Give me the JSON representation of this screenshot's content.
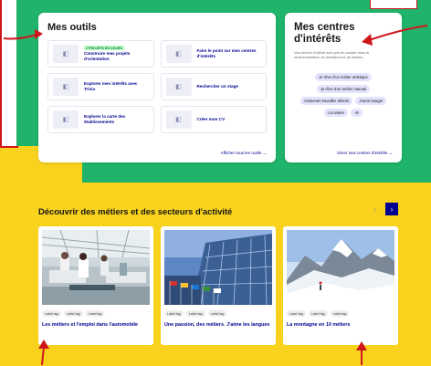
{
  "tools": {
    "title": "Mes outils",
    "items": [
      {
        "badge": "2 PROJETS EN COURS",
        "label": "Construire mes projets d'orientation"
      },
      {
        "badge": "",
        "label": "Faire le point sur mes centres d'intérêts"
      },
      {
        "badge": "",
        "label": "Explorer mes intérêts avec Trivia"
      },
      {
        "badge": "",
        "label": "Rechercher un stage"
      },
      {
        "badge": "",
        "label": "Explorer la carte des établissements"
      },
      {
        "badge": "",
        "label": "Créer mon CV"
      }
    ],
    "footer_link": "Afficher tous les outils →"
  },
  "centres": {
    "title_line1": "Mes centres",
    "title_line2": "d'intérêts",
    "description": "Vos centres d'intérêt sont pris en compte dans la recommandation de formations et de métiers.",
    "tags": [
      "Je rêve d'un métier artistique",
      "Je rêve d'un métier manuel",
      "J'aimerais travailler dehors",
      "J'aime bouger",
      "La nature",
      "+5"
    ],
    "footer_link": "Gérer mes centres d'intérêts →"
  },
  "discover": {
    "title": "Découvrir des métiers et des secteurs d'activité",
    "prev_label": "‹",
    "next_label": "›",
    "cards": [
      {
        "tags": [
          "Label tag",
          "Label tag",
          "Label tag"
        ],
        "title": "Les métiers et l'emploi dans l'automobile"
      },
      {
        "tags": [
          "Label tag",
          "Label tag",
          "Label tag"
        ],
        "title": "Une passion, des métiers. J'aime les langues"
      },
      {
        "tags": [
          "Label tag",
          "Label tag",
          "Label tag"
        ],
        "title": "La montagne en 10 métiers"
      }
    ]
  },
  "colors": {
    "green": "#1fb36b",
    "yellow": "#f8d21c",
    "blue": "#000091",
    "red": "#d0161c"
  }
}
